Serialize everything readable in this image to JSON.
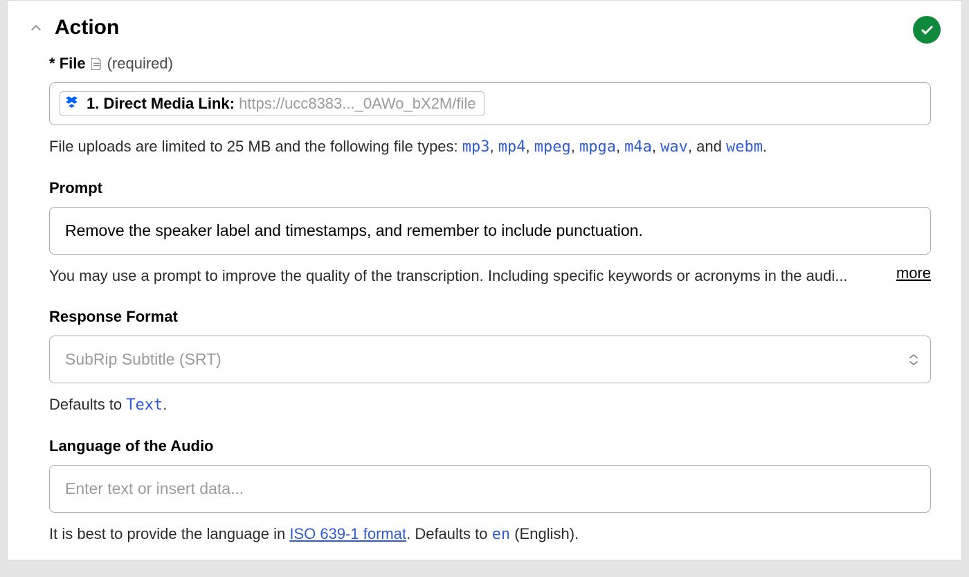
{
  "header": {
    "title": "Action"
  },
  "file": {
    "asterisk": "*",
    "label": "File",
    "required": "(required)",
    "chip_label": "1. Direct Media Link: ",
    "chip_url": "https://ucc8383..._0AWo_bX2M/file",
    "help_prefix": "File uploads are limited to 25 MB and the following file types: ",
    "types": [
      "mp3",
      "mp4",
      "mpeg",
      "mpga",
      "m4a",
      "wav"
    ],
    "help_and": ", and ",
    "type_last": "webm",
    "help_period": "."
  },
  "prompt": {
    "label": "Prompt",
    "value": "Remove the speaker label and timestamps, and remember to include punctuation.",
    "help": "You may use a prompt to improve the quality of the transcription. Including specific keywords or acronyms in the audi...",
    "more": "more"
  },
  "format": {
    "label": "Response Format",
    "value": "SubRip Subtitle (SRT)",
    "help_prefix": "Defaults to ",
    "help_code": "Text",
    "help_suffix": "."
  },
  "language": {
    "label": "Language of the Audio",
    "placeholder": "Enter text or insert data...",
    "help_prefix": "It is best to provide the language in ",
    "link": "ISO 639-1 format",
    "help_mid": ". Defaults to ",
    "code": "en",
    "help_suffix": " (English)."
  }
}
